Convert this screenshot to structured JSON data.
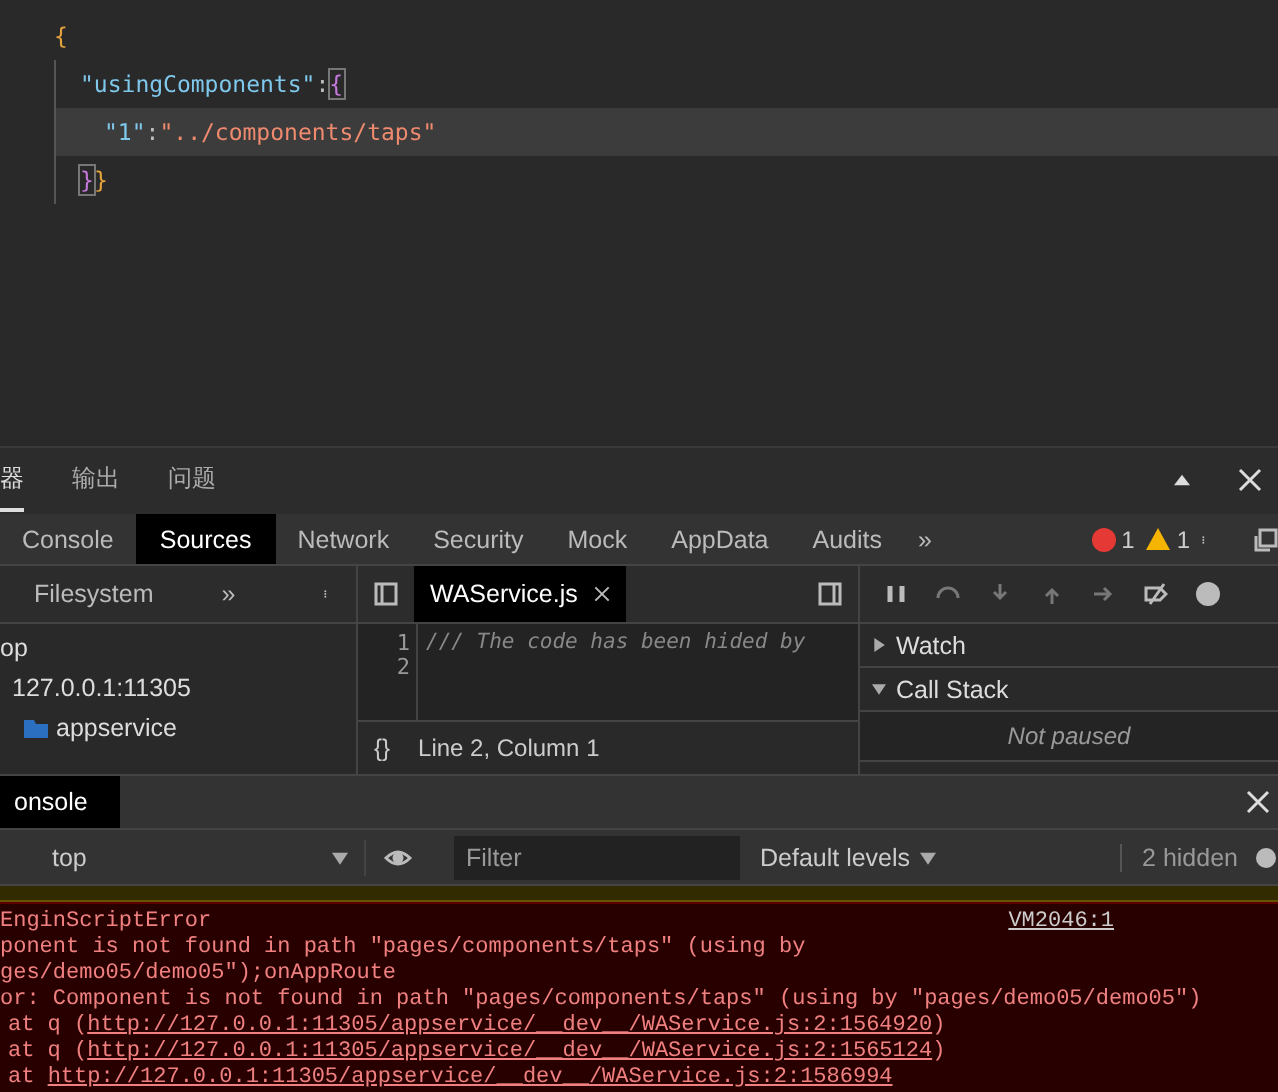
{
  "editor": {
    "lines": [
      {
        "highlighted": false,
        "kind": "open",
        "tokens": [
          {
            "kind": "brace",
            "text": "{"
          }
        ]
      },
      {
        "highlighted": false,
        "kind": "member",
        "tokens": [
          {
            "kind": "key",
            "text": "\"usingComponents\""
          },
          {
            "kind": "punct",
            "text": ":"
          },
          {
            "kind": "bracket",
            "text": "{"
          }
        ]
      },
      {
        "highlighted": true,
        "kind": "entry",
        "tokens": [
          {
            "kind": "key",
            "text": "\"1\""
          },
          {
            "kind": "punct",
            "text": ":"
          },
          {
            "kind": "string",
            "text": "\"../components/taps\""
          }
        ]
      },
      {
        "highlighted": false,
        "kind": "close",
        "tokens": [
          {
            "kind": "bracket",
            "text": "}"
          },
          {
            "kind": "brace",
            "text": "}"
          }
        ]
      }
    ]
  },
  "panel_tabs": [
    {
      "label": "器",
      "selected": true
    },
    {
      "label": "输出",
      "selected": false
    },
    {
      "label": "问题",
      "selected": false
    }
  ],
  "devtools_tabs": [
    {
      "label": "Console",
      "selected": false
    },
    {
      "label": "Sources",
      "selected": true
    },
    {
      "label": "Network",
      "selected": false
    },
    {
      "label": "Security",
      "selected": false
    },
    {
      "label": "Mock",
      "selected": false
    },
    {
      "label": "AppData",
      "selected": false
    },
    {
      "label": "Audits",
      "selected": false
    }
  ],
  "more_tabs": "»",
  "error_count": "1",
  "warning_count": "1",
  "navigator": {
    "tab": "Filesystem",
    "more": "»",
    "tree": [
      {
        "label": "op",
        "children": [
          {
            "label": "127.0.0.1:11305",
            "children": [
              {
                "label": "appservice",
                "kind": "folder"
              }
            ]
          }
        ]
      }
    ]
  },
  "source": {
    "file_tab": "WAService.js",
    "lines": [
      {
        "number": "1",
        "text": "/// The code has been hided by"
      },
      {
        "number": "2"
      }
    ],
    "format": "{}",
    "status": "Line 2, Column 1"
  },
  "debugger": {
    "sections": [
      {
        "label": "Watch",
        "expanded": false
      },
      {
        "label": "Call Stack",
        "expanded": true,
        "message": "Not paused"
      }
    ]
  },
  "console": {
    "tab": "onsole",
    "context": "top",
    "filter_placeholder": "Filter",
    "levels": "Default levels",
    "hidden": "2 hidden",
    "error": {
      "source": "VM2046:1",
      "lines": [
        {
          "kind": "text",
          "text": "EnginScriptError"
        },
        {
          "kind": "text",
          "text": "ponent is not found in path \"pages/components/taps\" (using by"
        },
        {
          "kind": "text",
          "text": "ges/demo05/demo05\");onAppRoute"
        },
        {
          "kind": "text",
          "text": "or: Component is not found in path \"pages/components/taps\" (using by \"pages/demo05/demo05\")"
        },
        {
          "kind": "stack",
          "before": "at q (",
          "link": "http://127.0.0.1:11305/appservice/__dev__/WAService.js:2:1564920",
          "after": ")"
        },
        {
          "kind": "stack",
          "before": "at q (",
          "link": "http://127.0.0.1:11305/appservice/__dev__/WAService.js:2:1565124",
          "after": ")"
        },
        {
          "kind": "stack",
          "before": "at ",
          "link": "http://127.0.0.1:11305/appservice/__dev__/WAService.js:2:1586994"
        }
      ]
    }
  }
}
